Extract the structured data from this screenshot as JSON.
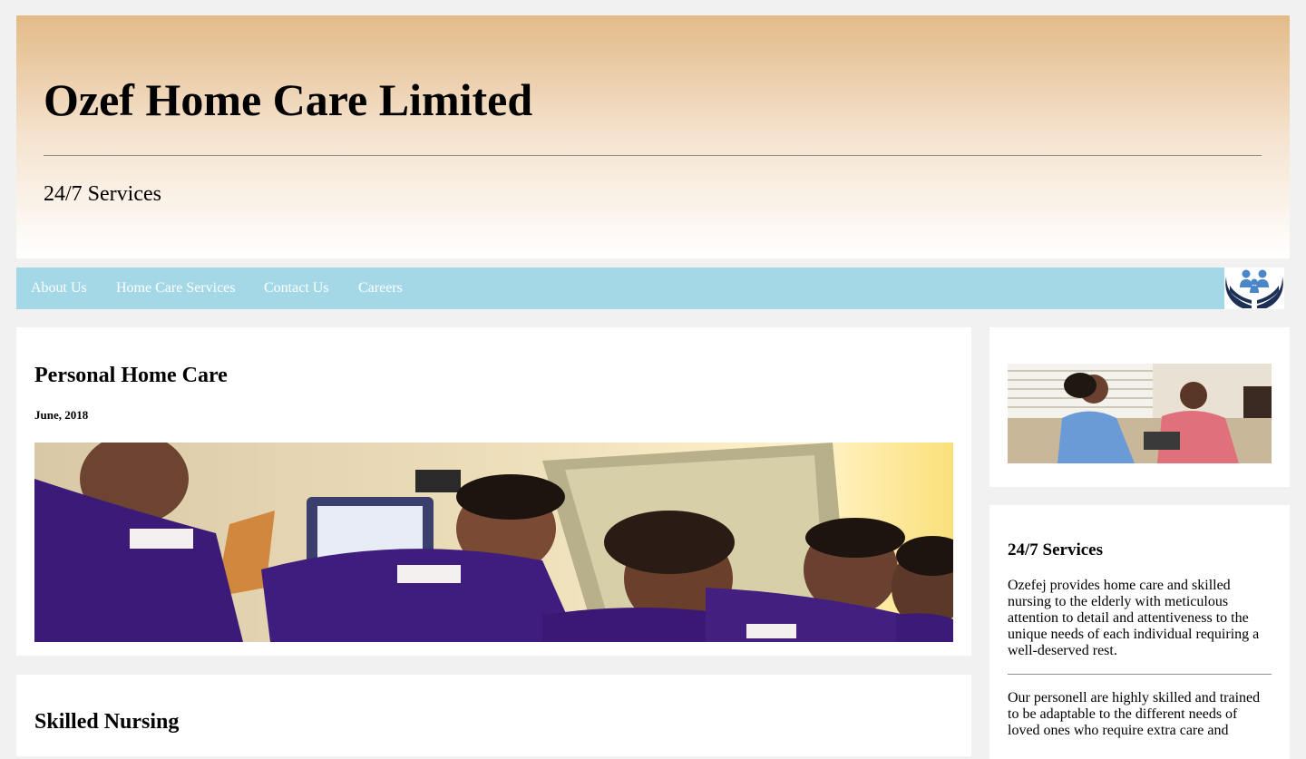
{
  "header": {
    "title": "Ozef Home Care Limited",
    "tagline": "24/7 Services"
  },
  "nav": {
    "items": [
      "About Us",
      "Home Care Services",
      "Contact Us",
      "Careers"
    ],
    "logo_icon": "family-in-hands-icon"
  },
  "main": {
    "posts": [
      {
        "title": "Personal Home Care",
        "date": "June, 2018",
        "image": "nurses-group-photo"
      },
      {
        "title": "Skilled Nursing"
      }
    ]
  },
  "sidebar": {
    "image": "nurse-with-elderly-patient-photo",
    "section_title": "24/7 Services",
    "paragraph1": "Ozefej provides home care and skilled nursing to the elderly with meticulous attention to detail and attentiveness to the unique needs of each individual requiring a well-deserved rest.",
    "paragraph2": "Our personell are highly skilled and trained to be adaptable to the different needs of loved ones who require extra care and"
  },
  "colors": {
    "header_top": "#e3bb88",
    "nav_bg": "#a4d8e6",
    "nav_text": "#ffffff",
    "page_bg": "#f1f1f1",
    "scrub_purple": "#3c1a78"
  }
}
